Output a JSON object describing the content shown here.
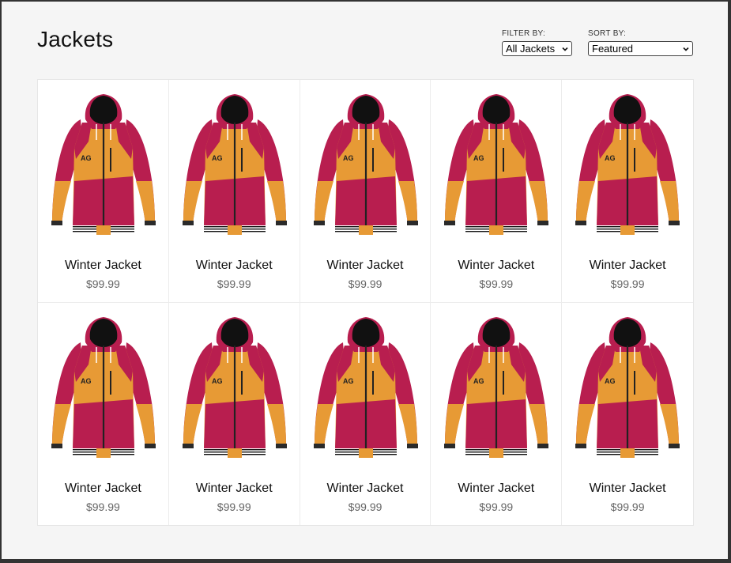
{
  "page": {
    "title": "Jackets"
  },
  "filter": {
    "label": "FILTER BY:",
    "value": "All Jackets"
  },
  "sort": {
    "label": "SORT BY:",
    "value": "Featured"
  },
  "colors": {
    "jacket_primary": "#b81e4f",
    "jacket_secondary": "#e79a35",
    "hood": "#111111",
    "zipper": "#222222"
  },
  "products": [
    {
      "name": "Winter Jacket",
      "price": "$99.99",
      "image_icon": "jacket-icon"
    },
    {
      "name": "Winter Jacket",
      "price": "$99.99",
      "image_icon": "jacket-icon"
    },
    {
      "name": "Winter Jacket",
      "price": "$99.99",
      "image_icon": "jacket-icon"
    },
    {
      "name": "Winter Jacket",
      "price": "$99.99",
      "image_icon": "jacket-icon"
    },
    {
      "name": "Winter Jacket",
      "price": "$99.99",
      "image_icon": "jacket-icon"
    },
    {
      "name": "Winter Jacket",
      "price": "$99.99",
      "image_icon": "jacket-icon"
    },
    {
      "name": "Winter Jacket",
      "price": "$99.99",
      "image_icon": "jacket-icon"
    },
    {
      "name": "Winter Jacket",
      "price": "$99.99",
      "image_icon": "jacket-icon"
    },
    {
      "name": "Winter Jacket",
      "price": "$99.99",
      "image_icon": "jacket-icon"
    },
    {
      "name": "Winter Jacket",
      "price": "$99.99",
      "image_icon": "jacket-icon"
    }
  ]
}
